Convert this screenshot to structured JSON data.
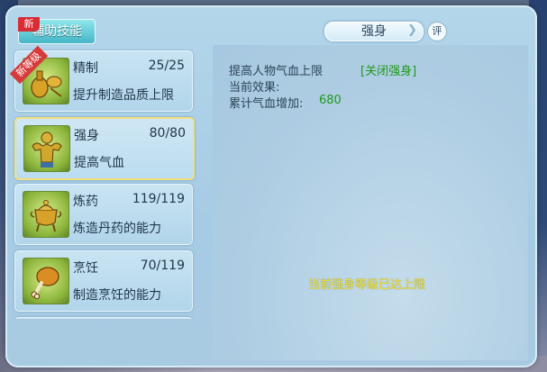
{
  "tab": {
    "label": "辅助技能",
    "badge": "新"
  },
  "title": {
    "text": "强身",
    "rate_label": "评"
  },
  "new_level_ribbon": "新等级",
  "skills": [
    {
      "name": "精制",
      "level": "25/25",
      "desc": "提升制造品质上限",
      "icon": "alchemy-tools-icon"
    },
    {
      "name": "强身",
      "level": "80/80",
      "desc": "提高气血",
      "icon": "strongman-icon"
    },
    {
      "name": "炼药",
      "level": "119/119",
      "desc": "炼造丹药的能力",
      "icon": "cauldron-icon"
    },
    {
      "name": "烹饪",
      "level": "70/119",
      "desc": "制造烹饪的能力",
      "icon": "drumstick-icon"
    }
  ],
  "detail": {
    "line1": "提高人物气血上限",
    "toggle": "[关闭强身]",
    "line2": "当前效果:",
    "line3_label": "累计气血增加:",
    "line3_value": "680"
  },
  "max_note": "当前强身等级已达上限",
  "colors": {
    "highlight_green": "#1d9a18",
    "note_yellow": "#f3e23a",
    "selected_border": "#f3e07a"
  }
}
